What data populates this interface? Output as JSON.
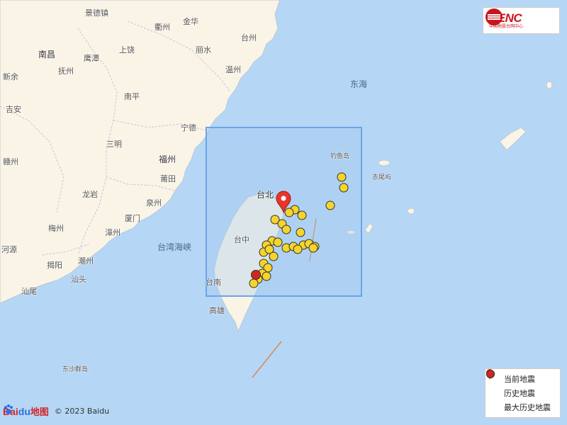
{
  "logo": {
    "text": "CENC",
    "subtext": "中国地震台网中心"
  },
  "places": {
    "jingdezhen": "景德镇",
    "quzhou": "衢州",
    "jinhua": "金华",
    "taizhou": "台州",
    "nanchang": "南昌",
    "yingtan": "鹰潭",
    "shangrao": "上饶",
    "lishui": "丽水",
    "wenzhou": "温州",
    "xinyu": "新余",
    "fuzhou_jx": "抚州",
    "nanping": "南平",
    "ji_an": "吉安",
    "ningde": "宁德",
    "sanming": "三明",
    "fuzhou": "福州",
    "ganzhou": "赣州",
    "putian": "莆田",
    "longyan": "龙岩",
    "quanzhou": "泉州",
    "xiamen": "厦门",
    "meizhou": "梅州",
    "zhangzhou": "漳州",
    "heyuan": "河源",
    "chaozhou": "潮州",
    "jieyang": "揭阳",
    "shantou": "汕头",
    "shanwei": "汕尾",
    "taibei": "台北",
    "taizhong": "台中",
    "tainan": "台南",
    "gaoxiong": "高雄"
  },
  "seas": {
    "east_sea": "东海",
    "strait": "台湾海峡",
    "dongsha": "东沙群岛",
    "diaoyu": "钓鱼岛",
    "chiwei": "赤尾屿"
  },
  "legend": {
    "current": "当前地震",
    "history": "历史地震",
    "max_history": "最大历史地震"
  },
  "colors": {
    "land": "#faf4e6",
    "sea": "#b6d6f5",
    "history_fill": "#f5d42c",
    "max_fill": "#d2261e",
    "current_marker": "#e8362a",
    "box": "#6aa4e8"
  },
  "attribution": {
    "copyright": "© 2023 Baidu",
    "b1": "Bai",
    "b2": "du",
    "b3": "地图"
  }
}
